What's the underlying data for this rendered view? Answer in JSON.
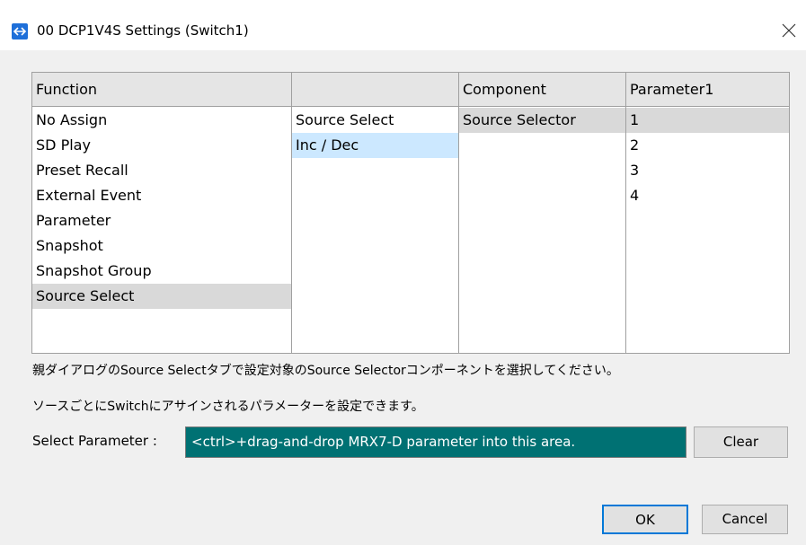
{
  "window": {
    "title": "00 DCP1V4S Settings (Switch1)",
    "app_icon": "dcp-icon",
    "close_icon": "close-icon"
  },
  "columns": {
    "function": {
      "header": "Function",
      "items": [
        "No Assign",
        "SD Play",
        "Preset Recall",
        "External Event",
        "Parameter",
        "Snapshot",
        "Snapshot Group",
        "Source Select"
      ],
      "selected": "Source Select"
    },
    "sub": {
      "header": "",
      "items": [
        "Source Select",
        "Inc / Dec"
      ],
      "selected": "Inc / Dec"
    },
    "component": {
      "header": "Component",
      "items": [
        "Source Selector"
      ],
      "selected": "Source Selector"
    },
    "parameter1": {
      "header": "Parameter1",
      "items": [
        "1",
        "2",
        "3",
        "4"
      ],
      "selected": "1"
    }
  },
  "info": {
    "line1": "親ダイアログのSource Selectタブで設定対象のSource Selectorコンポーネントを選択してください。",
    "line2": "ソースごとにSwitchにアサインされるパラメーターを設定できます。"
  },
  "select_parameter": {
    "label": "Select Parameter :",
    "value": "<ctrl>+drag-and-drop MRX7-D parameter into this area.",
    "clear_label": "Clear"
  },
  "footer": {
    "ok_label": "OK",
    "cancel_label": "Cancel"
  },
  "colors": {
    "accent": "#007173",
    "selection_gray": "#d9d9d9",
    "selection_blue": "#cce8ff",
    "icon_blue": "#1e6fd9"
  }
}
